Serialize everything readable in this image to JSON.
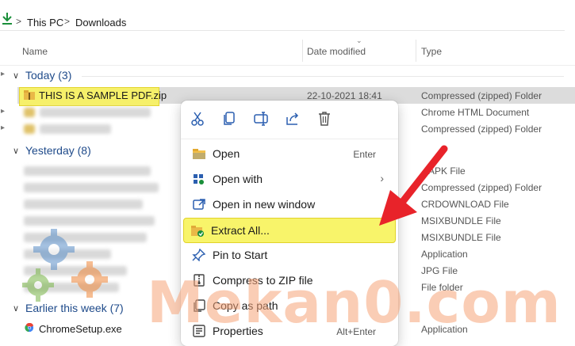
{
  "address": {
    "parts": [
      "This PC",
      "Downloads"
    ]
  },
  "columns": {
    "name": "Name",
    "date": "Date modified",
    "type": "Type"
  },
  "groups": [
    {
      "title": "Today (3)"
    },
    {
      "title": "Yesterday (8)"
    },
    {
      "title": "Earlier this week (7)"
    }
  ],
  "today_rows": [
    {
      "name": "THIS IS A SAMPLE PDF.zip",
      "date": "22-10-2021 18:41",
      "type": "Compressed (zipped) Folder"
    },
    {
      "name": "",
      "date": "",
      "type": "Chrome HTML Document"
    },
    {
      "name": "",
      "date": "",
      "type": "Compressed (zipped) Folder"
    }
  ],
  "yesterday_types": [
    "APK File",
    "Compressed (zipped) Folder",
    "CRDOWNLOAD File",
    "MSIXBUNDLE File",
    "MSIXBUNDLE File",
    "Application",
    "JPG File",
    "File folder"
  ],
  "earlier_rows": [
    {
      "name": "ChromeSetup.exe",
      "type": "Application"
    }
  ],
  "context_menu": {
    "toolbar": [
      "cut",
      "copy",
      "rename",
      "share",
      "delete"
    ],
    "items": [
      {
        "label": "Open",
        "shortcut": "Enter",
        "icon": "folder-icon"
      },
      {
        "label": "Open with",
        "shortcut": "",
        "icon": "open-with-icon",
        "submenu": true
      },
      {
        "label": "Open in new window",
        "shortcut": "",
        "icon": "new-window-icon"
      },
      {
        "label": "Extract All...",
        "shortcut": "",
        "icon": "extract-icon",
        "highlight": true
      },
      {
        "label": "Pin to Start",
        "shortcut": "",
        "icon": "pin-icon"
      },
      {
        "label": "Compress to ZIP file",
        "shortcut": "",
        "icon": "zip-icon"
      },
      {
        "label": "Copy as path",
        "shortcut": "",
        "icon": "copy-path-icon"
      },
      {
        "label": "Properties",
        "shortcut": "Alt+Enter",
        "icon": "properties-icon"
      }
    ]
  },
  "watermark": "Mekan0.com",
  "colors": {
    "highlight": "#f8f46a",
    "arrow": "#e8232a",
    "group": "#1e4a8a",
    "selected": "#dcdcdc"
  }
}
